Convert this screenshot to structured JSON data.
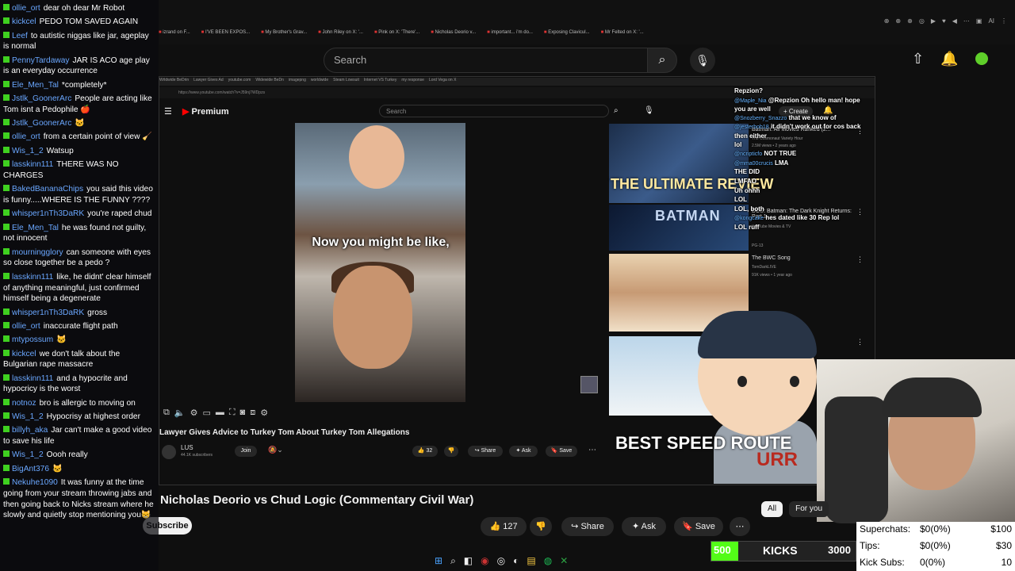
{
  "browser": {
    "tabs": [
      "izrand on F...",
      "I'VE BEEN EXPOS...",
      "My Brother's Grav...",
      "John Riley on X: '...",
      "Pink on X: 'There'...",
      "Nicholas Deorio v...",
      "important... i'm do...",
      "Exposing Clavicul...",
      "Mr Felted on X: '..."
    ],
    "extensions": [
      "⊕",
      "⊕",
      "⊕",
      "◎",
      "▶",
      "♥",
      "◀",
      "⋯",
      "▣",
      "AI",
      "⋮"
    ]
  },
  "header": {
    "search_placeholder": "Search",
    "logo_text": "Premium"
  },
  "inner": {
    "tabs": [
      "Wrldwide BeDrin",
      "Lawyer Gives Ad",
      "youtube.com",
      "Widewide BeDn",
      "imagepng",
      "worldwide",
      "Steam Lowsuit",
      "Internet VS Turkey",
      "my response",
      "Lord Vega on X"
    ],
    "url": "https://www.youtube.com/watch?v=J59nj7WDpzs",
    "logo": "Premium",
    "search_placeholder": "Search",
    "create_label": "+ Create",
    "caption": "Now you might be like,",
    "video_title": "Lawyer Gives Advice to Turkey Tom About Turkey Tom Allegations",
    "channel": "LUS",
    "subs": "44.1K subscribers",
    "join_label": "Join",
    "like_count": "32",
    "share_label": "Share",
    "ask_label": "Ask",
    "save_label": "Save",
    "sidebar": [
      {
        "thumb_text": "THE ULTIMATE REVIEW",
        "title": "Batman: All Movies Ranked (2...",
        "channel": "The Cosmonaut Variety Hour",
        "meta": "2.5M views • 2 years ago"
      },
      {
        "thumb_text": "BATMAN",
        "title": "DCU: Batman: The Dark Knight Returns: Part 1",
        "channel": "YouTube Movies & TV",
        "meta": "PG-13"
      },
      {
        "thumb_text": "",
        "title": "The BWC Song",
        "channel": "TomDarkLIVE",
        "meta": "91K views • 1 year ago"
      }
    ],
    "overlay_chat": [
      {
        "user": "",
        "text": "Repzion?"
      },
      {
        "user": "@Maple_Nia",
        "text": "@Repzion Oh hello man! hope you are well"
      },
      {
        "user": "@Snozberry_Snazzo",
        "text": "that we know of"
      },
      {
        "user": "@jesterbob18",
        "text": "it didn't work out for cos back then either"
      },
      {
        "user": "",
        "text": "lol"
      },
      {
        "user": "@ncripticfo",
        "text": "NOT TRUE"
      },
      {
        "user": "@mma00crucis",
        "text": "LMA"
      },
      {
        "user": "",
        "text": "THE DID"
      },
      {
        "user": "",
        "text": "LMFAO"
      },
      {
        "user": "",
        "text": "Uh ohhh"
      },
      {
        "user": "",
        "text": "LOL"
      },
      {
        "user": "",
        "text": "LOL, both"
      },
      {
        "user": "@kongcake",
        "text": "hes dated like 30 Rep lol"
      },
      {
        "user": "",
        "text": "LOL ruff"
      }
    ],
    "best_speed": "BEST SPEED ROUTE",
    "cartoon_text": "URR"
  },
  "main": {
    "video_title": "Nicholas Deorio vs Chud Logic (Commentary Civil War)",
    "subscribe_label": "Subscribe",
    "like_count": "127",
    "share_label": "Share",
    "ask_label": "Ask",
    "save_label": "Save",
    "chips": [
      "All",
      "For you"
    ]
  },
  "kicks": {
    "min": "500",
    "label": "KICKS",
    "max": "3000",
    "progress": 0.0
  },
  "stats": [
    {
      "label": "Superchats:",
      "value": "$0(0%)",
      "goal": "$100"
    },
    {
      "label": "Tips:",
      "value": "$0(0%)",
      "goal": "$30"
    },
    {
      "label": "Kick Subs:",
      "value": "0(0%)",
      "goal": "10"
    }
  ],
  "taskbar": [
    "⊞",
    "⌕",
    "◧",
    "◉",
    "◎",
    "◐",
    "▤",
    "◍",
    "✕"
  ],
  "chat": [
    {
      "user": "ollie_ort",
      "text": "dear oh dear Mr Robot"
    },
    {
      "user": "kickcel",
      "text": "PEDO TOM SAVED AGAIN"
    },
    {
      "user": "Leef",
      "text": "to autistic niggas like jar, ageplay is normal"
    },
    {
      "user": "PennyTardaway",
      "text": "JAR IS ACO age play is an everyday occurrence"
    },
    {
      "user": "Ele_Men_Tal",
      "text": "*completely*"
    },
    {
      "user": "Jstlk_GoonerArc",
      "text": "People are acting like Tom isnt a Pedophile 🍎"
    },
    {
      "user": "Jstlk_GoonerArc",
      "text": "🐱"
    },
    {
      "user": "ollie_ort",
      "text": "from a certain point of view 🧹"
    },
    {
      "user": "Wis_1_2",
      "text": "Watsup"
    },
    {
      "user": "lasskinn111",
      "text": "THERE WAS NO CHARGES"
    },
    {
      "user": "BakedBananaChips",
      "text": "you said this video is funny.....WHERE IS THE FUNNY ????"
    },
    {
      "user": "whisper1nTh3DaRK",
      "text": "you're raped chud"
    },
    {
      "user": "Ele_Men_Tal",
      "text": "he was found not guilty, not innocent"
    },
    {
      "user": "mourningglory",
      "text": "can someone with eyes so close together be a pedo ?"
    },
    {
      "user": "lasskinn111",
      "text": "like, he didnt' clear himself of anything meaningful, just confirmed himself being a degenerate"
    },
    {
      "user": "whisper1nTh3DaRK",
      "text": "gross"
    },
    {
      "user": "ollie_ort",
      "text": "inaccurate flight path"
    },
    {
      "user": "mtypossum",
      "text": "🐱"
    },
    {
      "user": "kickcel",
      "text": "we don't talk about the Bulgarian rape massacre"
    },
    {
      "user": "lasskinn111",
      "text": "and a hypocrite and hypocricy is the worst"
    },
    {
      "user": "notnoz",
      "text": "bro is allergic to moving on"
    },
    {
      "user": "Wis_1_2",
      "text": "Hypocrisy at highest order"
    },
    {
      "user": "billyh_aka",
      "text": "Jar can't make a good video to save his life"
    },
    {
      "user": "Wis_1_2",
      "text": "Oooh really"
    },
    {
      "user": "BigAnt376",
      "text": "🐱"
    },
    {
      "user": "Nekuhe1090",
      "text": "It was funny at the time going from your stream throwing jabs and then going back to Nicks stream where he slowly and quietly stop mentioning you😸"
    }
  ]
}
